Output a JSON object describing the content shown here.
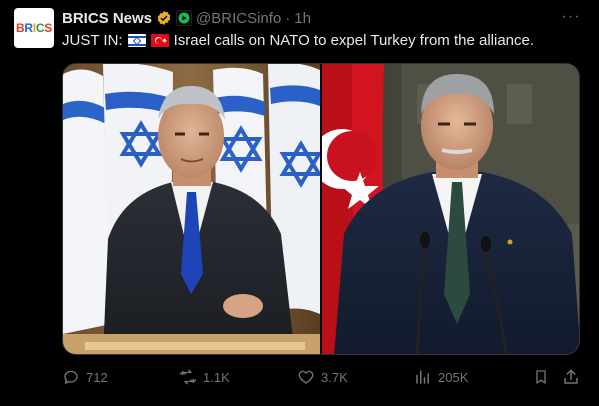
{
  "account": {
    "avatar_text": [
      "B",
      "R",
      "I",
      "C",
      "S"
    ],
    "name": "BRICS News",
    "handle": "@BRICSinfo",
    "separator": "·",
    "time": "1h"
  },
  "menu": {
    "more_label": "···"
  },
  "tweet": {
    "prefix": "JUST IN:",
    "body": "Israel calls on NATO to expel Turkey from the alliance."
  },
  "media": {
    "left_subject": "israel-flag-speaker-photo",
    "right_subject": "turkey-flag-speaker-photo"
  },
  "actions": {
    "replies": "712",
    "reposts": "1.1K",
    "likes": "3.7K",
    "views": "205K"
  },
  "colors": {
    "background": "#000000",
    "text": "#e7e9ea",
    "muted": "#71767b",
    "verified": "#e8b11f",
    "border": "#2f3336"
  }
}
